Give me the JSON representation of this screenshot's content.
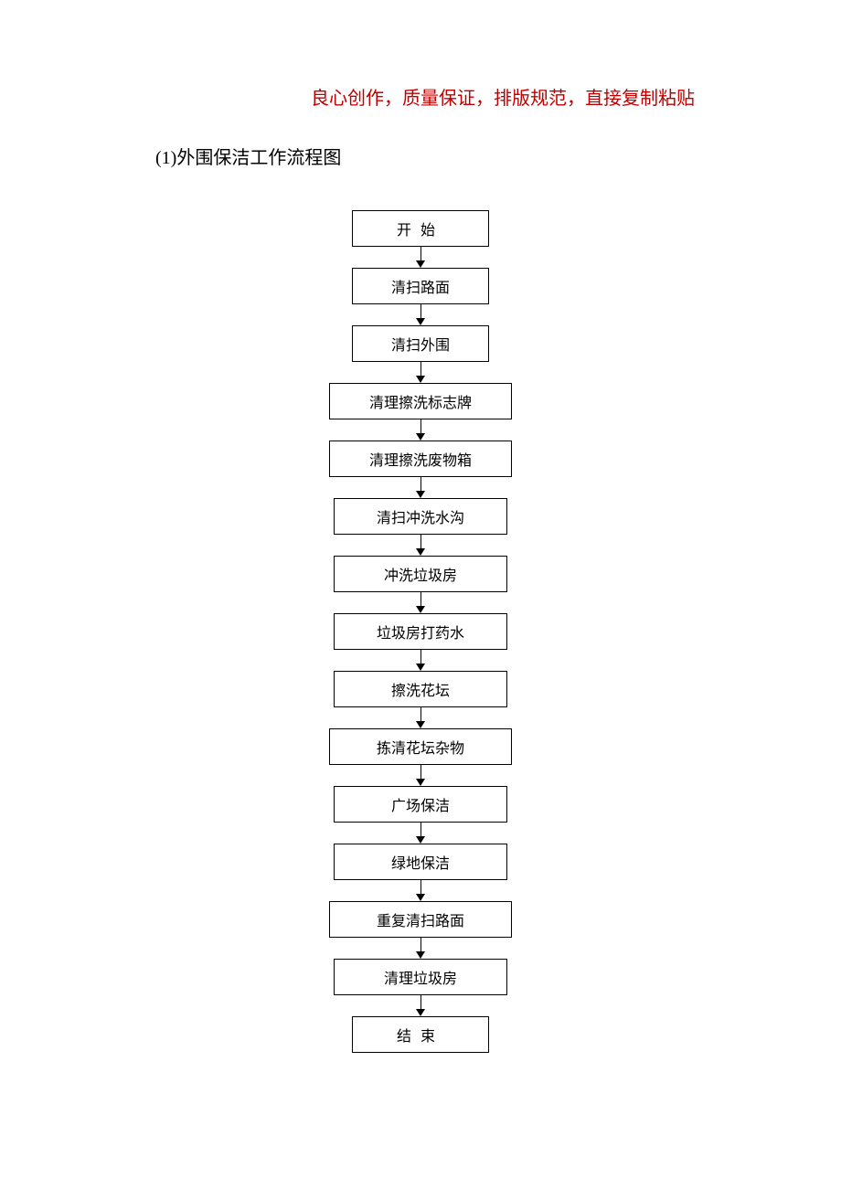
{
  "header": {
    "red_text": "良心创作，质量保证，排版规范，直接复制粘贴"
  },
  "section": {
    "title": "(1)外围保洁工作流程图"
  },
  "flow": {
    "start": "开始",
    "step1": "清扫路面",
    "step2": "清扫外围",
    "step3": "清理擦洗标志牌",
    "step4": "清理擦洗废物箱",
    "step5": "清扫冲洗水沟",
    "step6": "冲洗垃圾房",
    "step7": "垃圾房打药水",
    "step8": "擦洗花坛",
    "step9": "拣清花坛杂物",
    "step10": "广场保洁",
    "step11": "绿地保洁",
    "step12": "重复清扫路面",
    "step13": "清理垃圾房",
    "end": "结束"
  }
}
